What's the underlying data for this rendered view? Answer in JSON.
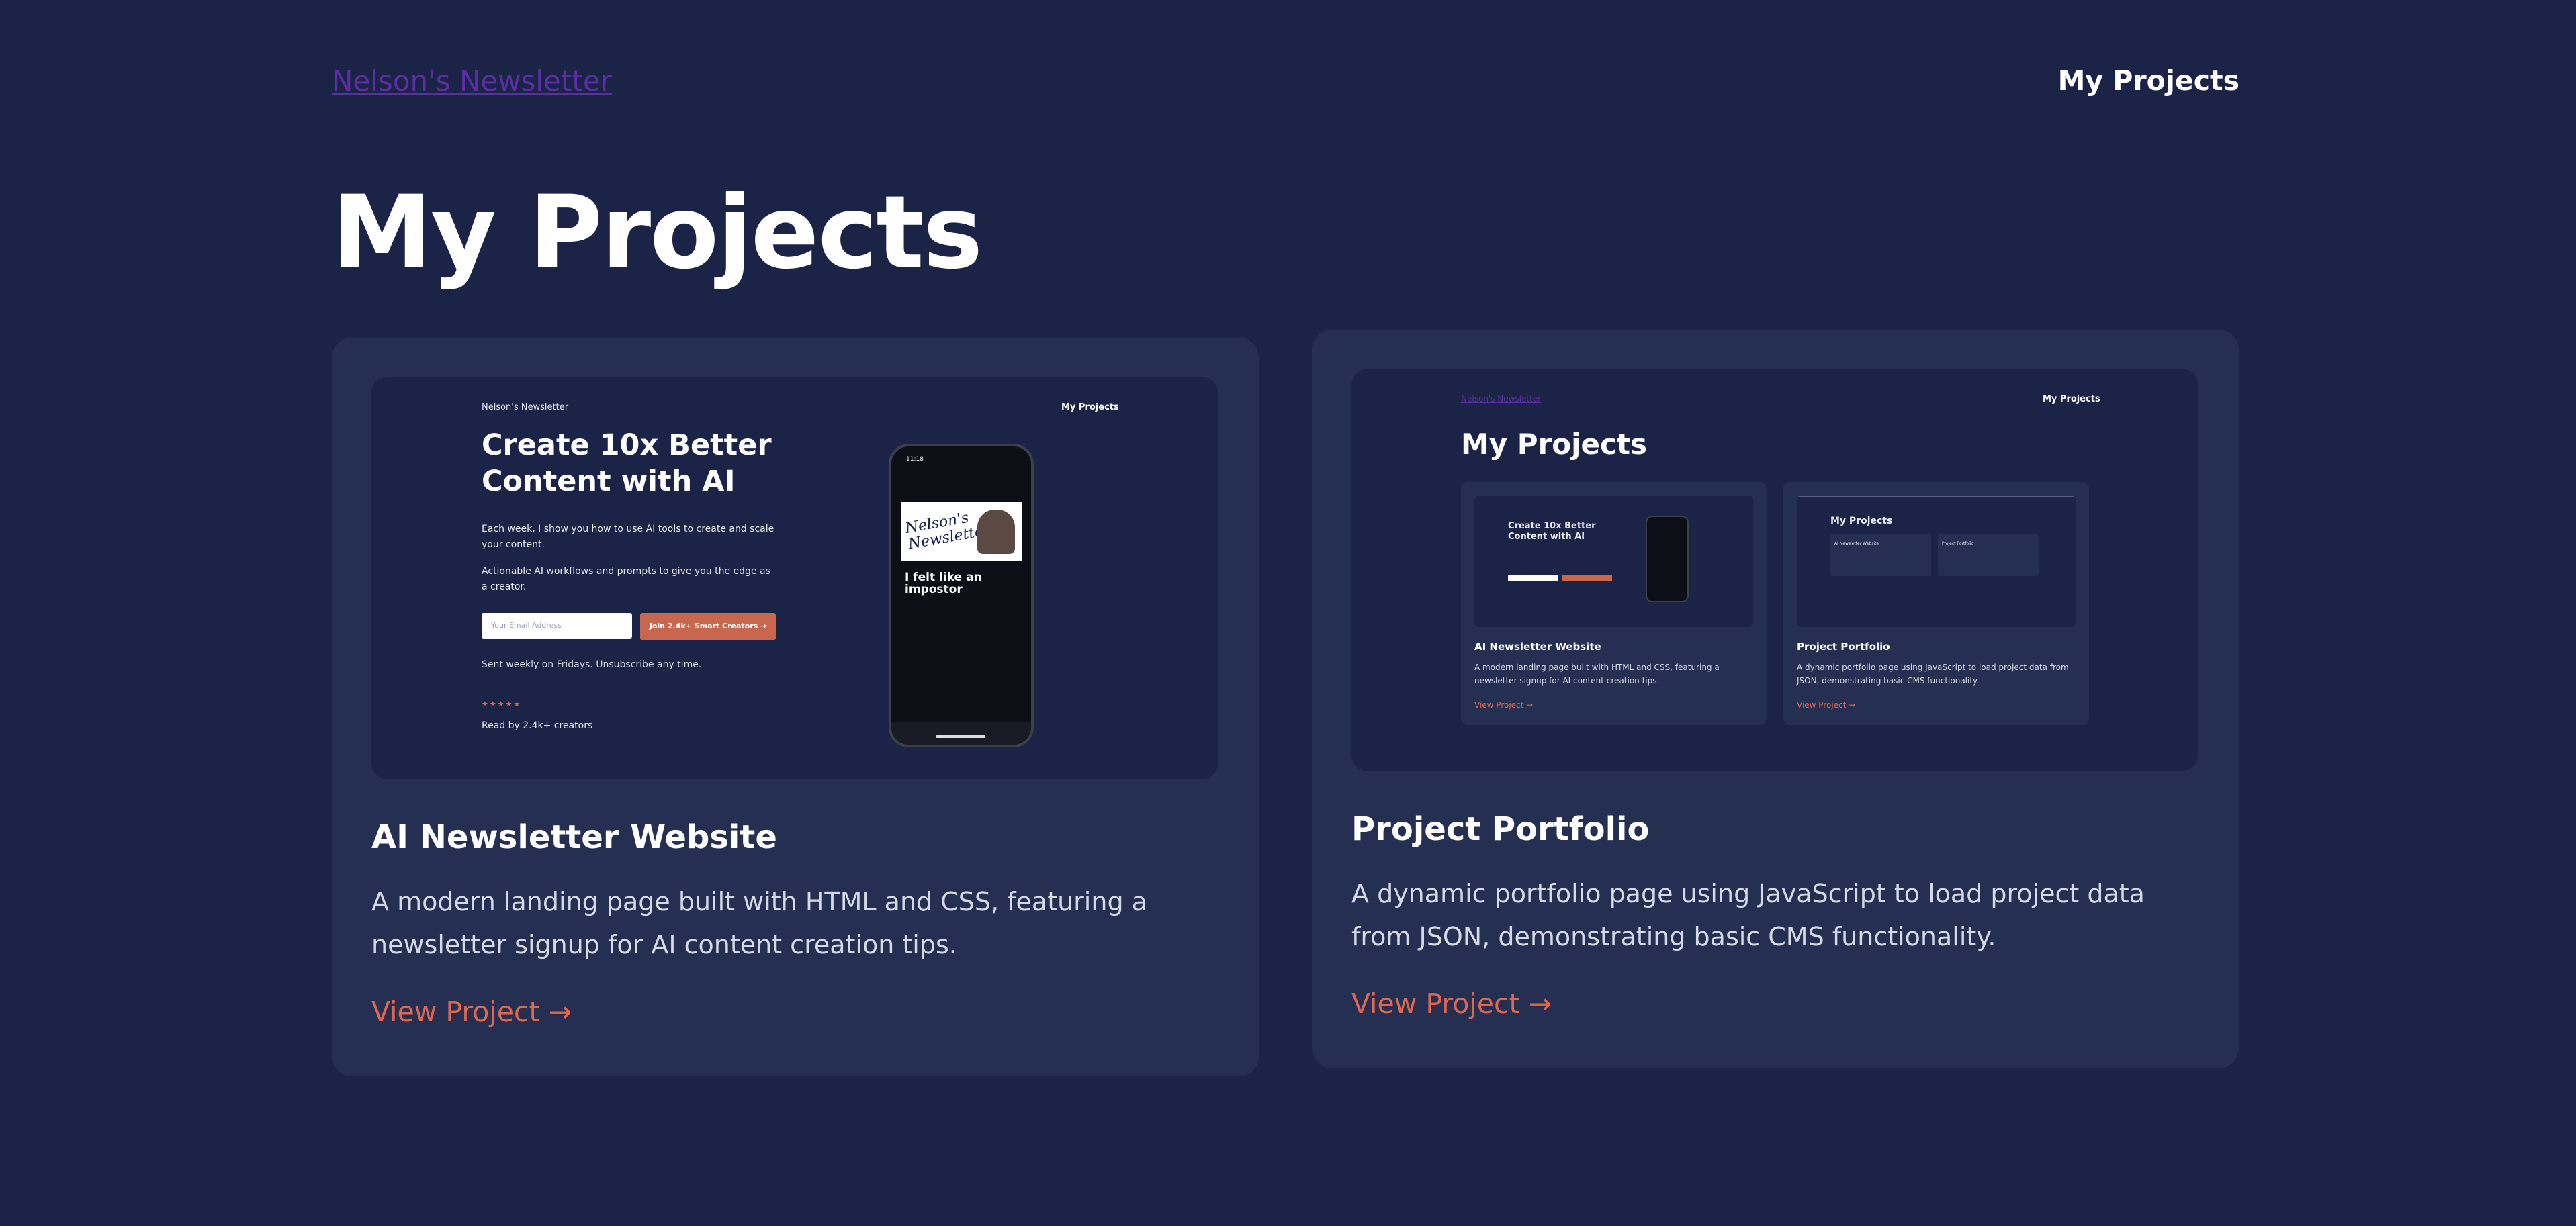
{
  "header": {
    "brand": "Nelson's Newsletter",
    "nav_link": "My Projects"
  },
  "page": {
    "title": "My Projects"
  },
  "projects": [
    {
      "title": "AI Newsletter Website",
      "description": "A modern landing page built with HTML and CSS, featuring a newsletter signup for AI content creation tips.",
      "link": "View Project →",
      "preview": {
        "brand": "Nelson's Newsletter",
        "nav": "My Projects",
        "headline": "Create 10x Better Content with AI",
        "para1": "Each week, I show you how to use AI tools to create and scale your content.",
        "para2": "Actionable AI workflows and prompts to give you the edge as a creator.",
        "email_placeholder": "Your Email Address",
        "button": "Join 2.4k+ Smart Creators →",
        "sent": "Sent weekly on Fridays. Unsubscribe any time.",
        "stars": "★★★★★",
        "read_by": "Read by 2.4k+ creators",
        "phone": {
          "time": "11:18",
          "signature": "Nelson's Newsletter",
          "heading": "I felt like an impostor"
        }
      }
    },
    {
      "title": "Project Portfolio",
      "description": "A dynamic portfolio page using JavaScript to load project data from JSON, demonstrating basic CMS functionality.",
      "link": "View Project →",
      "preview": {
        "brand": "Nelson's Newsletter",
        "nav": "My Projects",
        "title": "My Projects",
        "cards": [
          {
            "title": "AI Newsletter Website",
            "description": "A modern landing page built with HTML and CSS, featuring a newsletter signup for AI content creation tips.",
            "link": "View Project →",
            "headline": "Create 10x Better Content with AI"
          },
          {
            "title": "Project Portfolio",
            "description": "A dynamic portfolio page using JavaScript to load project data from JSON, demonstrating basic CMS functionality.",
            "link": "View Project →",
            "inner_title": "My Projects",
            "inner_card1": "AI Newsletter Website",
            "inner_card2": "Project Portfolio"
          }
        ]
      }
    }
  ],
  "colors": {
    "background": "#1b2447",
    "card": "#252f52",
    "accent": "#e0674f",
    "brand_link": "#5b2ea6"
  }
}
